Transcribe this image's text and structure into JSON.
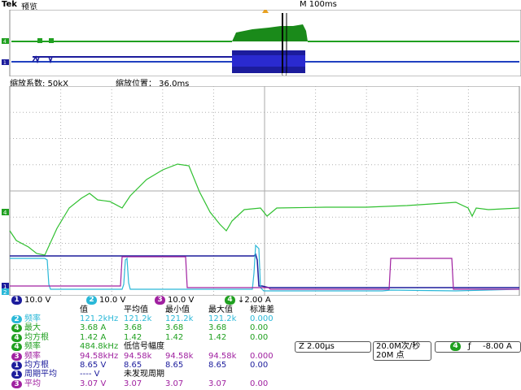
{
  "header": {
    "brand": "Tek",
    "mode": "预览",
    "timebase": "M 100ms"
  },
  "zoom": {
    "factor_label": "缩放系数: 50kX",
    "position_label": "缩放位置： 36.0ms"
  },
  "channels": [
    {
      "num": "1",
      "value": "10.0 V",
      "color": "#1c1c9c"
    },
    {
      "num": "2",
      "value": "10.0 V",
      "color": "#2ab8d8"
    },
    {
      "num": "3",
      "value": "10.0 V",
      "color": "#a020a0"
    },
    {
      "num": "4",
      "value": "↓2.00 A",
      "color": "#20a020"
    }
  ],
  "measurements": {
    "headers": [
      "值",
      "平均值",
      "最小值",
      "最大值",
      "标准差"
    ],
    "rows": [
      {
        "ch": "2",
        "chcolor": "#2ab8d8",
        "name": "频率",
        "value": "121.2kHz",
        "mean": "121.2k",
        "min": "121.2k",
        "max": "121.2k",
        "std": "0.000"
      },
      {
        "ch": "4",
        "chcolor": "#20a020",
        "name": "最大",
        "value": "3.68 A",
        "mean": "3.68",
        "min": "3.68",
        "max": "3.68",
        "std": "0.00"
      },
      {
        "ch": "4",
        "chcolor": "#20a020",
        "name": "均方根",
        "value": "1.42 A",
        "mean": "1.42",
        "min": "1.42",
        "max": "1.42",
        "std": "0.00"
      },
      {
        "ch": "4",
        "chcolor": "#20a020",
        "name": "频率",
        "value": "484.8kHz",
        "mean": "低信号幅度",
        "min": "",
        "max": "",
        "std": ""
      },
      {
        "ch": "3",
        "chcolor": "#a020a0",
        "name": "频率",
        "value": "94.58kHz",
        "mean": "94.58k",
        "min": "94.58k",
        "max": "94.58k",
        "std": "0.000"
      },
      {
        "ch": "1",
        "chcolor": "#1c1c9c",
        "name": "均方根",
        "value": "8.65 V",
        "mean": "8.65",
        "min": "8.65",
        "max": "8.65",
        "std": "0.00"
      },
      {
        "ch": "1",
        "chcolor": "#1c1c9c",
        "name": "周期平均",
        "value": "---- V",
        "mean": "未发现周期",
        "min": "",
        "max": "",
        "std": ""
      },
      {
        "ch": "3",
        "chcolor": "#a020a0",
        "name": "平均",
        "value": "3.07 V",
        "mean": "3.07",
        "min": "3.07",
        "max": "3.07",
        "std": "0.00"
      }
    ]
  },
  "settings": {
    "zoom_time": "Z 2.00μs",
    "sample_rate": "20.0M次/秒",
    "record_length": "20M 点",
    "trigger_channel": "4",
    "trigger_slope": "ƒ",
    "trigger_level": "-8.00 A"
  }
}
